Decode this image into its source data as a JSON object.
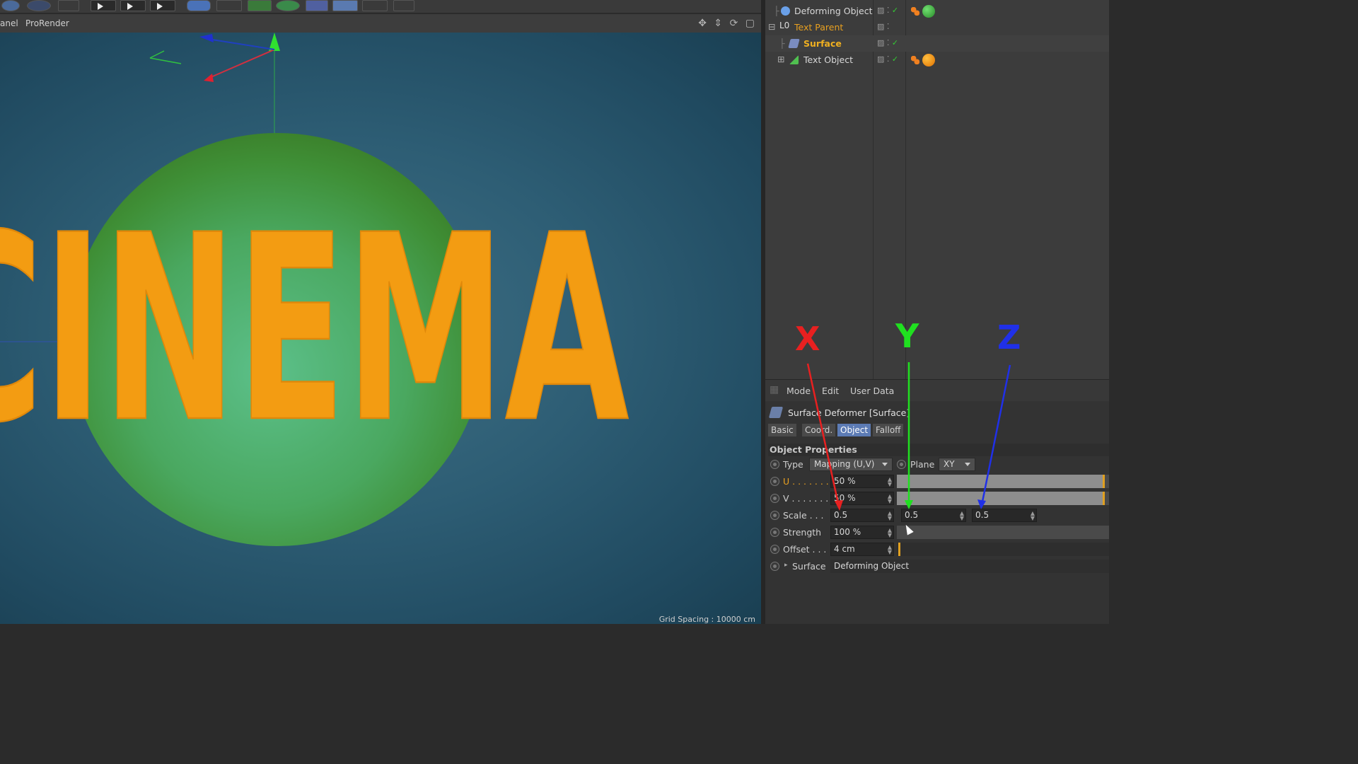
{
  "menubar": {
    "panel_label": "anel",
    "prorender_label": "ProRender"
  },
  "viewport": {
    "sphere_text": "CINEMA",
    "grid_spacing": "Grid Spacing : 10000 cm"
  },
  "object_manager": {
    "items": [
      {
        "label": "Deforming Object",
        "color": "#d0d0d0",
        "expand": "",
        "icon": "sphere-icon"
      },
      {
        "label": "Text Parent",
        "color": "#e8a020",
        "expand": "⊟",
        "icon": "null-icon"
      },
      {
        "label": "Surface",
        "color": "#f0b020",
        "expand": "",
        "icon": "surface-deformer-icon"
      },
      {
        "label": "Text Object",
        "color": "#d0d0d0",
        "expand": "⊞",
        "icon": "extrude-icon"
      }
    ]
  },
  "attribute_manager": {
    "menu": {
      "mode": "Mode",
      "edit": "Edit",
      "user_data": "User Data"
    },
    "title": "Surface Deformer [Surface]",
    "tabs": {
      "basic": "Basic",
      "coord": "Coord.",
      "object": "Object",
      "falloff": "Falloff"
    },
    "section": "Object Properties",
    "type": {
      "label": "Type",
      "value": "Mapping (U,V)"
    },
    "plane": {
      "label": "Plane",
      "value": "XY"
    },
    "u": {
      "label": "U . . . . . . . .",
      "value": "50 %",
      "fraction": 0.98
    },
    "v": {
      "label": "V . . . . . . . .",
      "value": "50 %",
      "fraction": 0.98
    },
    "scale": {
      "label": "Scale . . .",
      "x": "0.5",
      "y": "0.5",
      "z": "0.5"
    },
    "strength": {
      "label": "Strength",
      "value": "100 %"
    },
    "offset": {
      "label": "Offset . . .",
      "value": "4 cm"
    },
    "surface": {
      "label": "Surface",
      "value": "Deforming Object"
    }
  },
  "annotations": {
    "x": "X",
    "y": "Y",
    "z": "Z"
  },
  "colors": {
    "x": "#e82020",
    "y": "#20e020",
    "z": "#2030e8",
    "accent": "#5c7bb5"
  }
}
